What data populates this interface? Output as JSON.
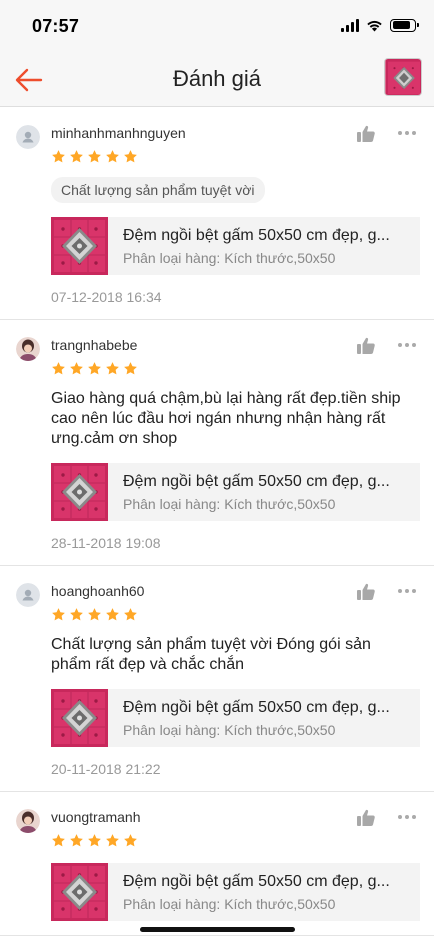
{
  "status_bar": {
    "time": "07:57",
    "battery_level": 0.85
  },
  "header": {
    "title": "Đánh giá",
    "back_icon": "arrow-left-icon",
    "accent_color": "#ee4d2d"
  },
  "colors": {
    "star": "#ffa726",
    "product_pink": "#d9346a"
  },
  "reviews": [
    {
      "username": "minhanhmanhnguyen",
      "avatar": "default",
      "rating": 5,
      "tag": "Chất lượng sản phẩm tuyệt vời",
      "comment": "",
      "product_name": "Đệm ngồi bệt gấm 50x50 cm đẹp, g...",
      "product_variant": "Phân loại hàng: Kích thước,50x50",
      "date": "07-12-2018 16:34"
    },
    {
      "username": "trangnhabebe",
      "avatar": "photo",
      "rating": 5,
      "tag": "",
      "comment": "Giao hàng quá chậm,bù lại hàng rất đẹp.tiền ship cao nên lúc đầu hơi ngán nhưng nhận hàng rất ưng.cảm ơn shop",
      "product_name": "Đệm ngồi bệt gấm 50x50 cm đẹp, g...",
      "product_variant": "Phân loại hàng: Kích thước,50x50",
      "date": "28-11-2018 19:08"
    },
    {
      "username": "hoanghoanh60",
      "avatar": "default",
      "rating": 5,
      "tag": "",
      "comment": " Chất lượng sản phẩm tuyệt vời Đóng gói sản phẩm rất đẹp và chắc chắn",
      "product_name": "Đệm ngồi bệt gấm 50x50 cm đẹp, g...",
      "product_variant": "Phân loại hàng: Kích thước,50x50",
      "date": "20-11-2018 21:22"
    },
    {
      "username": "vuongtramanh",
      "avatar": "photo",
      "rating": 5,
      "tag": "",
      "comment": "",
      "product_name": "Đệm ngồi bệt gấm 50x50 cm đẹp, g...",
      "product_variant": "Phân loại hàng: Kích thước,50x50",
      "date": ""
    }
  ]
}
